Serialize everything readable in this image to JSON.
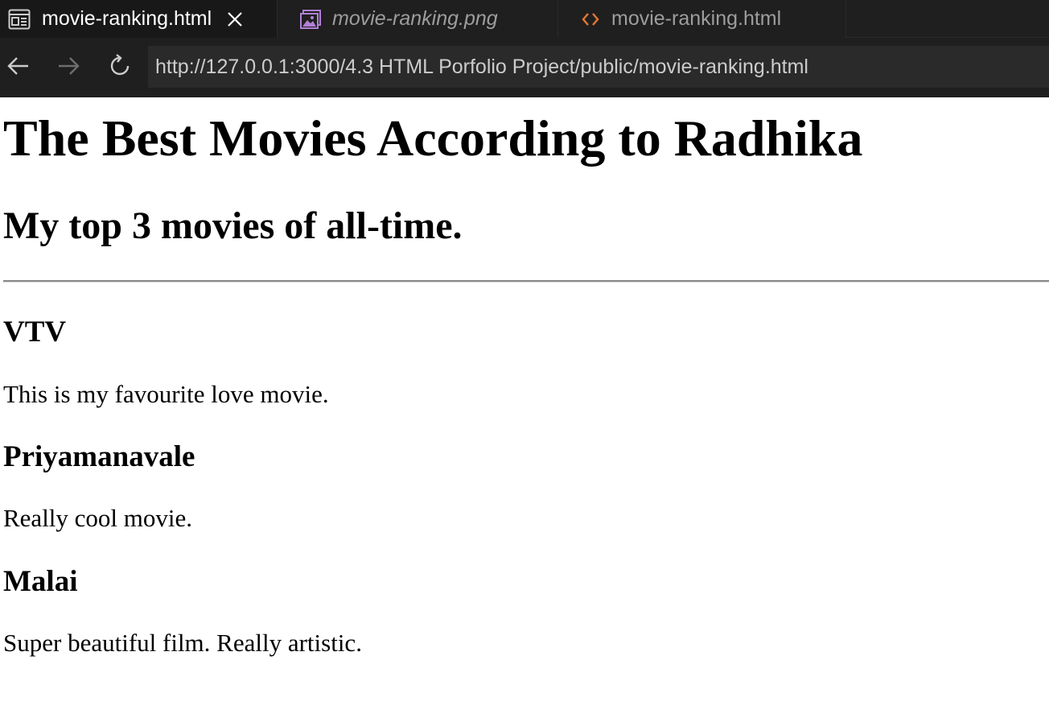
{
  "tabs": [
    {
      "label": "movie-ranking.html",
      "icon": "preview-icon",
      "active": true,
      "close_symbol": "✕"
    },
    {
      "label": "movie-ranking.png",
      "icon": "image-icon",
      "active": false
    },
    {
      "label": "movie-ranking.html",
      "icon": "code-icon",
      "active": false
    }
  ],
  "nav": {
    "url": "http://127.0.0.1:3000/4.3 HTML Porfolio Project/public/movie-ranking.html"
  },
  "page": {
    "title": "The Best Movies According to Radhika",
    "subtitle": "My top 3 movies of all-time.",
    "movies": [
      {
        "title": "VTV",
        "description": "This is my favourite love movie."
      },
      {
        "title": "Priyamanavale",
        "description": "Really cool movie."
      },
      {
        "title": "Malai",
        "description": "Super beautiful film. Really artistic."
      }
    ]
  },
  "colors": {
    "chrome_background": "#1f1f1f",
    "active_tab": "#181818",
    "url_field": "#2a2a2a",
    "image_icon": "#b180d7",
    "code_icon": "#e37933"
  }
}
